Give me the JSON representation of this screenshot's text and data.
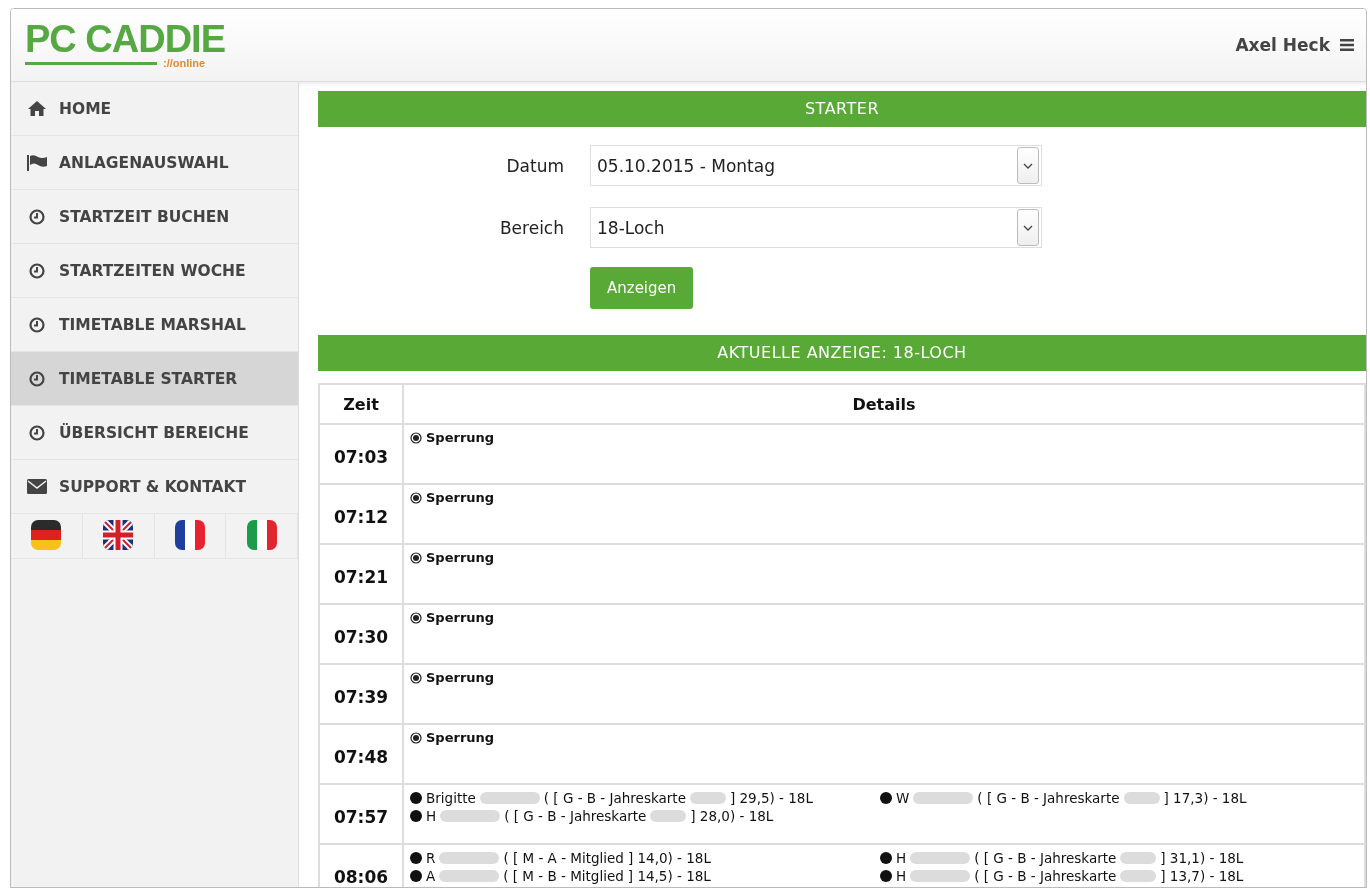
{
  "logo": {
    "title": "PC CADDIE",
    "subtitle": "://online"
  },
  "user": {
    "name": "Axel Heck"
  },
  "sidebar": {
    "items": [
      {
        "label": "HOME",
        "selected": false
      },
      {
        "label": "ANLAGENAUSWAHL",
        "selected": false
      },
      {
        "label": "STARTZEIT BUCHEN",
        "selected": false
      },
      {
        "label": "STARTZEITEN WOCHE",
        "selected": false
      },
      {
        "label": "TIMETABLE MARSHAL",
        "selected": false
      },
      {
        "label": "TIMETABLE STARTER",
        "selected": true
      },
      {
        "label": "ÜBERSICHT BEREICHE",
        "selected": false
      },
      {
        "label": "SUPPORT & KONTAKT",
        "selected": false
      }
    ]
  },
  "starter": {
    "title": "STARTER",
    "fields": [
      {
        "label": "Datum",
        "value": "05.10.2015 - Montag"
      },
      {
        "label": "Bereich",
        "value": "18-Loch"
      }
    ],
    "button": "Anzeigen"
  },
  "table": {
    "title": "AKTUELLE ANZEIGE: 18-LOCH",
    "columns": [
      "Zeit",
      "Details"
    ],
    "rows": [
      {
        "time": "07:03",
        "kind": "block",
        "label": "Sperrung"
      },
      {
        "time": "07:12",
        "kind": "block",
        "label": "Sperrung"
      },
      {
        "time": "07:21",
        "kind": "block",
        "label": "Sperrung"
      },
      {
        "time": "07:30",
        "kind": "block",
        "label": "Sperrung"
      },
      {
        "time": "07:39",
        "kind": "block",
        "label": "Sperrung"
      },
      {
        "time": "07:48",
        "kind": "block",
        "label": "Sperrung"
      },
      {
        "time": "07:57",
        "kind": "players",
        "players": [
          {
            "name": "Brigitte",
            "info": "( [ G - B - Jahreskarte",
            "club_redacted": true,
            "tail": "] 29,5) - 18L"
          },
          {
            "name": "W",
            "info": "( [ G - B - Jahreskarte",
            "club_redacted": true,
            "tail": "] 17,3) - 18L"
          },
          {
            "name": "H",
            "info": "( [ G - B - Jahreskarte",
            "club_redacted": true,
            "tail": "] 28,0) - 18L"
          }
        ]
      },
      {
        "time": "08:06",
        "kind": "players",
        "players": [
          {
            "name": "R",
            "info": "( [ M - A - Mitglied",
            "club_redacted": false,
            "tail": "] 14,0) - 18L"
          },
          {
            "name": "H",
            "info": "( [ G - B - Jahreskarte",
            "club_redacted": true,
            "tail": "] 31,1) - 18L"
          },
          {
            "name": "A",
            "info": "( [ M - B - Mitglied",
            "club_redacted": false,
            "tail": "] 14,5) - 18L"
          },
          {
            "name": "H",
            "info": "( [ G - B - Jahreskarte",
            "club_redacted": true,
            "tail": "] 13,7) - 18L"
          }
        ]
      }
    ]
  }
}
